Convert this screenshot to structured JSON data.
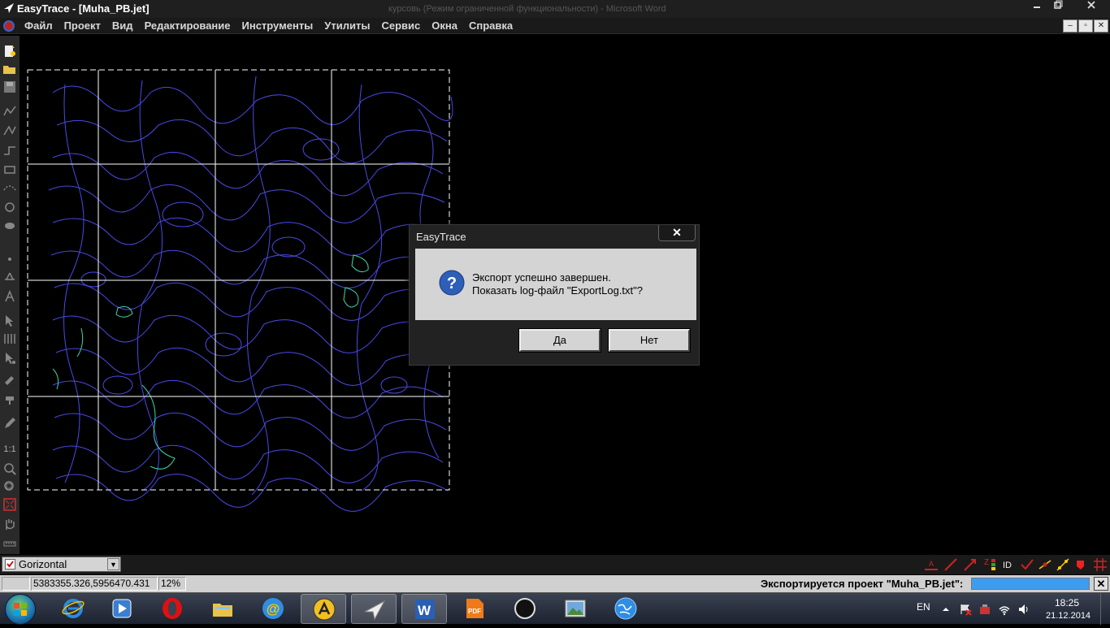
{
  "window": {
    "title": "EasyTrace - [Muha_PB.jet]",
    "background_title": "курсовь (Режим ограниченной функциональности) - Microsoft Word"
  },
  "menu": [
    "Файл",
    "Проект",
    "Вид",
    "Редактирование",
    "Инструменты",
    "Утилиты",
    "Сервис",
    "Окна",
    "Справка"
  ],
  "dialog": {
    "title": "EasyTrace",
    "close_label": "✕",
    "line1": "Экспорт успешно завершен.",
    "line2": "Показать log-файл \"ExportLog.txt\"?",
    "yes": "Да",
    "no": "Нет"
  },
  "layer": {
    "name": "Gorizontal"
  },
  "left_toolbar_scale": "1:1",
  "status": {
    "coords": "5383355.326,5956470.431",
    "zoom": "12%",
    "export_text": "Экспортируется проект \"Muha_PB.jet\":",
    "cancel": "✕"
  },
  "taskbar": {
    "lang": "EN",
    "time": "18:25",
    "date": "21.12.2014",
    "apps": [
      "internet-explorer-icon",
      "media-player-icon",
      "opera-icon",
      "file-explorer-icon",
      "mail-agent-icon",
      "autocad-icon",
      "easytrace-icon",
      "word-icon",
      "pdf-icon",
      "circle-app-icon",
      "image-viewer-icon",
      "globe-icon"
    ]
  }
}
